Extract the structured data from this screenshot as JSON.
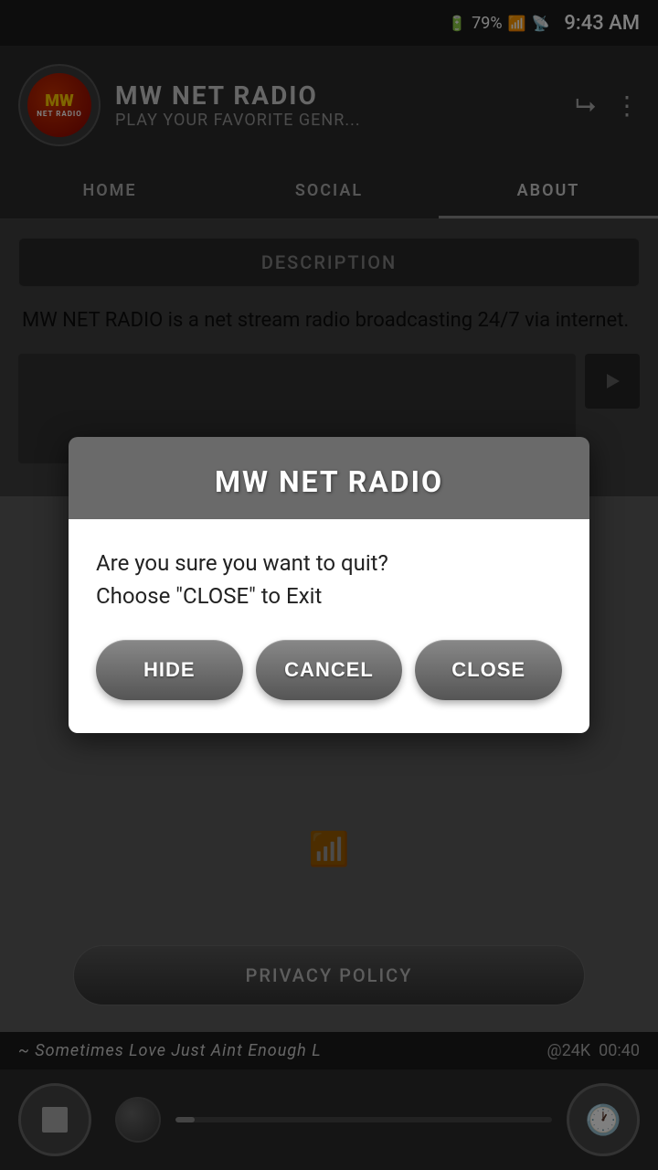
{
  "statusBar": {
    "battery": "79%",
    "time": "9:43 AM"
  },
  "header": {
    "appName": "MW NET RADIO",
    "subtitle": "PLAY YOUR FAVORITE GENR...",
    "logoTextTop": "MW",
    "logoTextBottom": "NET RADIO"
  },
  "navigation": {
    "tabs": [
      {
        "label": "HOME",
        "active": false
      },
      {
        "label": "SOCIAL",
        "active": false
      },
      {
        "label": "ABOUT",
        "active": true
      }
    ]
  },
  "aboutPage": {
    "descriptionLabel": "DESCRIPTION",
    "descriptionText": "MW NET RADIO is a net stream radio broadcasting 24/7 via internet.",
    "privacyLabel": "PRIVACY POLICY"
  },
  "dialog": {
    "title": "MW NET RADIO",
    "message": "Are you sure you want to quit?\nChoose \"CLOSE\" to Exit",
    "buttons": {
      "hide": "HIDE",
      "cancel": "CANCEL",
      "close": "CLOSE"
    }
  },
  "playerBar": {
    "marqueeText": "~ Sometimes Love Just Aint Enough L",
    "bitrate": "@24K",
    "time": "00:40"
  }
}
